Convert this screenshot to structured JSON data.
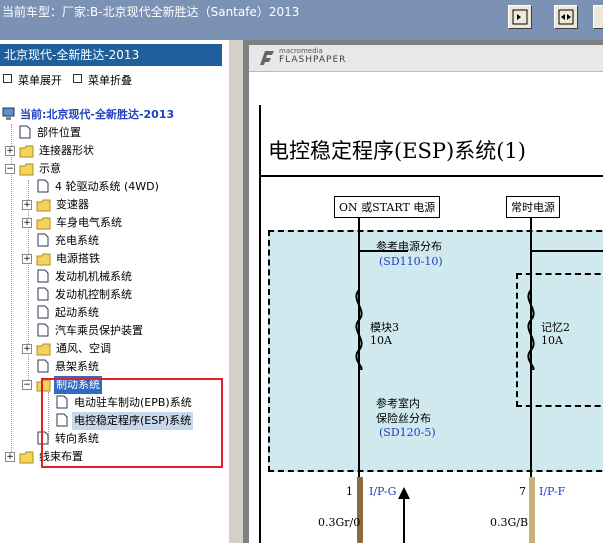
{
  "window": {
    "title": "当前车型：厂家:B-北京现代全新胜达（Santafe）2013"
  },
  "sidebar": {
    "header": "北京现代-全新胜达-2013",
    "expand_all": "菜单展开",
    "collapse_all": "菜单折叠",
    "current": "当前:北京现代-全新胜达-2013",
    "items": [
      {
        "label": "部件位置"
      },
      {
        "label": "连接器形状"
      },
      {
        "label": "示意"
      },
      {
        "label": "4 轮驱动系统 (4WD)"
      },
      {
        "label": "变速器"
      },
      {
        "label": "车身电气系统"
      },
      {
        "label": "充电系统"
      },
      {
        "label": "电源搭铁"
      },
      {
        "label": "发动机机械系统"
      },
      {
        "label": "发动机控制系统"
      },
      {
        "label": "起动系统"
      },
      {
        "label": "汽车乘员保护装置"
      },
      {
        "label": "通风、空调"
      },
      {
        "label": "悬架系统"
      },
      {
        "label": "制动系统"
      },
      {
        "label": "电动驻车制动(EPB)系统"
      },
      {
        "label": "电控稳定程序(ESP)系统"
      },
      {
        "label": "转向系统"
      },
      {
        "label": "线束布置"
      }
    ]
  },
  "viewer": {
    "brand_top": "macromedia",
    "brand_main": "FLASHPAPER",
    "doc_title": "电控稳定程序(ESP)系统(1)",
    "cap_left": "ON 或START 电源",
    "cap_right": "常时电源",
    "ref1": "参考电源分布",
    "ref1_code": "(SD110-10)",
    "fuse1_name": "模块3",
    "fuse1_amp": "10A",
    "fuse2_name": "记忆2",
    "fuse2_amp": "10A",
    "ref2a": "参考室内",
    "ref2b": "保险丝分布",
    "ref2_code": "(SD120-5)",
    "pin1": "1",
    "conn1": "I/P-G",
    "wire1": "0.3Gr/0",
    "pin2": "7",
    "conn2": "I/P-F",
    "wire2": "0.3G/B"
  },
  "colors": {
    "titlebar": "#7c92b4",
    "sidebar_header": "#1f5f9b",
    "selection": "#c8d8ec",
    "highlight_box": "#e0202a",
    "diagram_fill": "#cfe9ef",
    "ref_blue": "#1f3fc0"
  }
}
